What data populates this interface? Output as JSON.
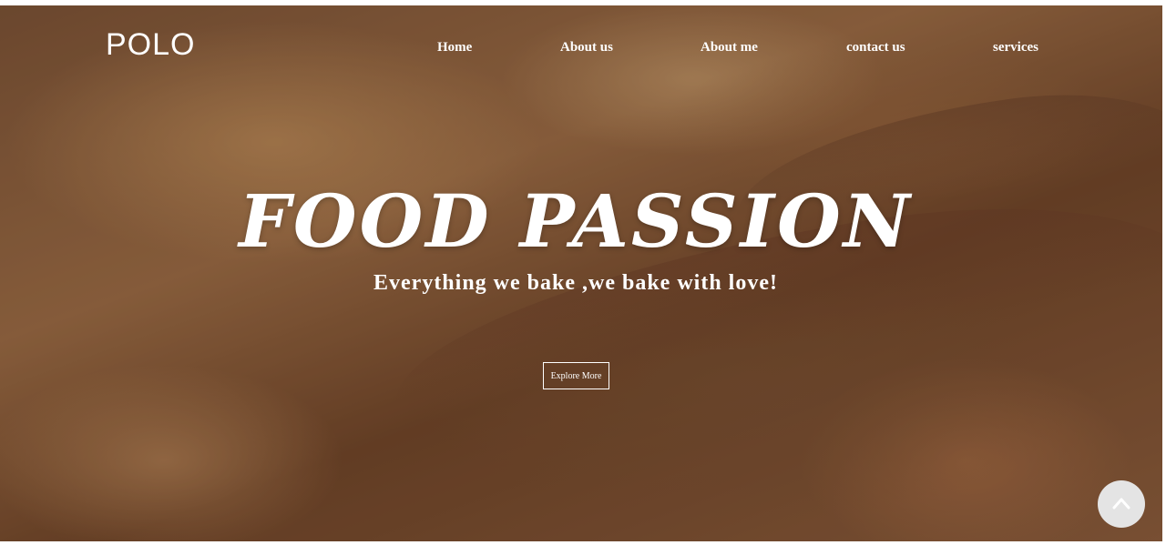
{
  "brand": {
    "logo": "POLO"
  },
  "nav": {
    "items": [
      {
        "label": "Home"
      },
      {
        "label": "About us"
      },
      {
        "label": "About me"
      },
      {
        "label": "contact us"
      },
      {
        "label": "services"
      }
    ]
  },
  "hero": {
    "title": "FOOD PASSION",
    "subtitle": "Everything we bake ,we bake with love!",
    "cta_label": "Explore More",
    "background": "bread-photo"
  },
  "scroll_top": {
    "icon": "chevron-up-icon"
  },
  "colors": {
    "text": "#ffffff",
    "scroll_button": "#e4e4e4"
  }
}
